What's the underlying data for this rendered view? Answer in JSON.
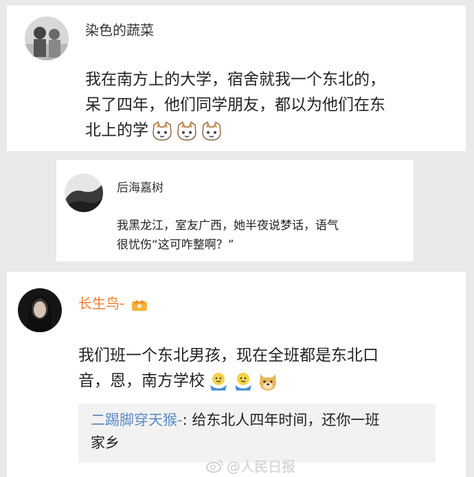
{
  "comments": [
    {
      "username": "染色的蔬菜",
      "line1": "我在南方上的大学，宿舍就我一个东北的，",
      "line2": "呆了四年，他们同学朋友，都以为他们在东",
      "line3": "北上的学",
      "emojis": [
        "cat-icon",
        "cat-icon",
        "cat-icon"
      ]
    },
    {
      "username": "后海嘉树",
      "line1": "我黑龙江，室友广西，她半夜说梦话，语气",
      "line2": "很忧伤“这可咋整啊？”"
    },
    {
      "username": "长生鸟-",
      "badge": "crown-badge-icon",
      "line1": "我们班一个东北男孩，现在全班都是东北口",
      "line2": "音，恩，南方学校",
      "emojis": [
        "hug-icon",
        "hug-icon",
        "doge-icon"
      ],
      "reply": {
        "username": "二踢脚穿天猴-",
        "text_line1": ": 给东北人四年时间，还你一班",
        "text_line2": "家乡"
      }
    }
  ],
  "watermark": "@人民日报",
  "colors": {
    "link": "#5a8bc4",
    "vip_name": "#f07c2d",
    "background": "#e9e9e9",
    "reply_bg": "#f2f2f2"
  }
}
